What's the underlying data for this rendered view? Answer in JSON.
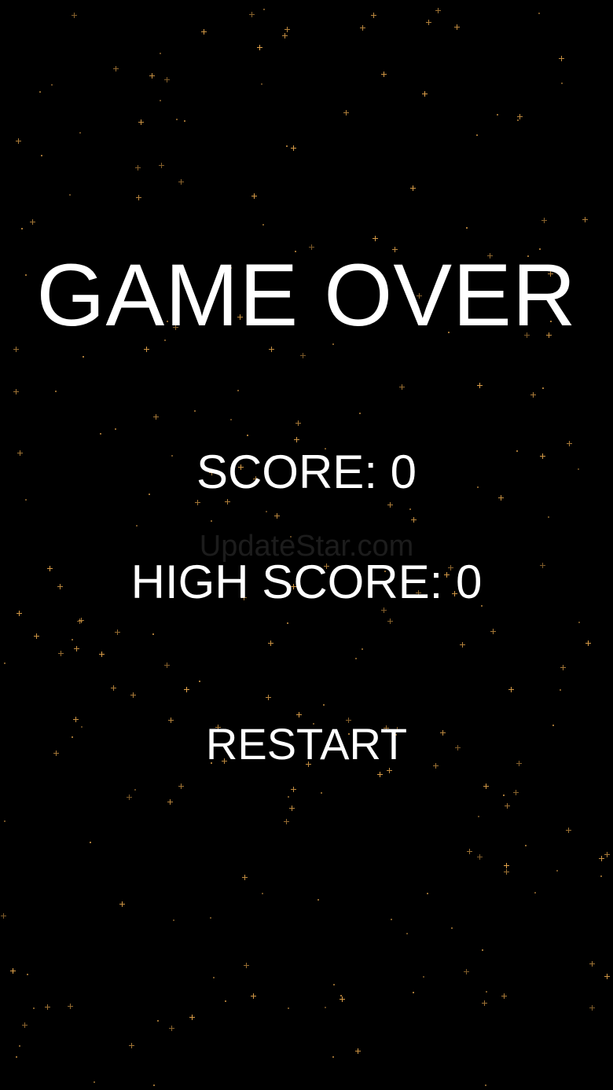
{
  "game": {
    "title": "GAME OVER",
    "score_line": "SCORE: 0",
    "high_score_line": "HIGH SCORE: 0",
    "restart_label": "RESTART",
    "watermark": "UpdateStar.com"
  },
  "colors": {
    "background": "#000000",
    "text": "#ffffff",
    "star": "#e0a24a"
  }
}
